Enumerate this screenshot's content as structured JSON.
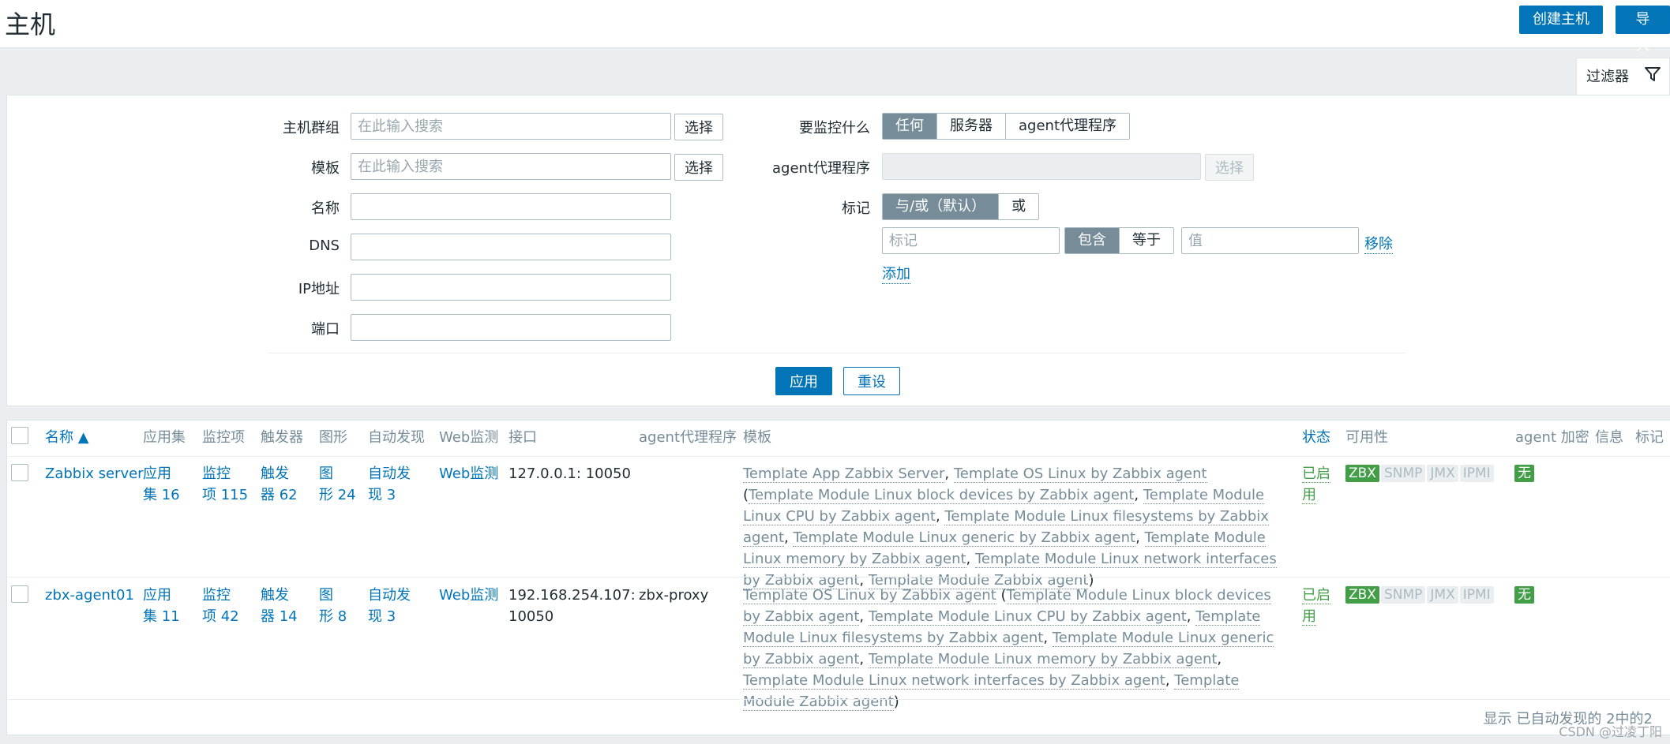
{
  "header": {
    "title": "主机",
    "create_label": "创建主机",
    "import_label": "导入"
  },
  "filter": {
    "tab_label": "过滤器",
    "host_group_label": "主机群组",
    "template_label": "模板",
    "name_label": "名称",
    "dns_label": "DNS",
    "ip_label": "IP地址",
    "port_label": "端口",
    "search_placeholder": "在此输入搜索",
    "select_label": "选择",
    "monitored_by_label": "要监控什么",
    "monitored_by_options": [
      "任何",
      "服务器",
      "agent代理程序"
    ],
    "proxy_label": "agent代理程序",
    "tags_label": "标记",
    "tag_eval_options": [
      "与/或（默认）",
      "或"
    ],
    "tag_placeholder": "标记",
    "tag_operators": [
      "包含",
      "等于"
    ],
    "value_placeholder": "值",
    "remove_label": "移除",
    "add_label": "添加",
    "apply_label": "应用",
    "reset_label": "重设"
  },
  "table": {
    "headers": {
      "name": "名称 ▲",
      "apps": "应用集",
      "items": "监控项",
      "triggers": "触发器",
      "graphs": "图形",
      "discovery": "自动发现",
      "web": "Web监测",
      "interface": "接口",
      "proxy": "agent代理程序",
      "templates": "模板",
      "status": "状态",
      "availability": "可用性",
      "encryption": "agent 加密",
      "info": "信息",
      "tags": "标记"
    },
    "availability_labels": [
      "ZBX",
      "SNMP",
      "JMX",
      "IPMI"
    ],
    "rows": [
      {
        "name": "Zabbix server",
        "apps_1": "应用",
        "apps_2": "集 16",
        "items_1": "监控",
        "items_2": "项 115",
        "triggers_1": "触发",
        "triggers_2": "器 62",
        "graphs_1": "图",
        "graphs_2": "形 24",
        "discovery_1": "自动发",
        "discovery_2": "现 3",
        "web": "Web监测",
        "interface_1": "127.0.0.1: 10050",
        "interface_2": "",
        "proxy": "",
        "templates": {
          "t0": "Template App Zabbix Server",
          "t1": "Template OS Linux by Zabbix agent",
          "t2": "Template Module Linux block devices by Zabbix agent",
          "t3": "Template Module Linux CPU by Zabbix agent",
          "t4": "Template Module Linux filesystems by Zabbix agent",
          "t5": "Template Module Linux generic by Zabbix agent",
          "t6": "Template Module Linux memory by Zabbix agent",
          "t7": "Template Module Linux network interfaces by Zabbix agent",
          "t8": "Template Module Zabbix agent"
        },
        "status": "已启用",
        "encryption": "无"
      },
      {
        "name": "zbx-agent01",
        "apps_1": "应用",
        "apps_2": "集 11",
        "items_1": "监控",
        "items_2": "项 42",
        "triggers_1": "触发",
        "triggers_2": "器 14",
        "graphs_1": "图",
        "graphs_2": "形 8",
        "discovery_1": "自动发",
        "discovery_2": "现 3",
        "web": "Web监测",
        "interface_1": "192.168.254.107:",
        "interface_2": "10050",
        "proxy": "zbx-proxy",
        "templates": {
          "t1": "Template OS Linux by Zabbix agent",
          "t2": "Template Module Linux block devices by Zabbix agent",
          "t3": "Template Module Linux CPU by Zabbix agent",
          "t4": "Template Module Linux filesystems by Zabbix agent",
          "t5": "Template Module Linux generic by Zabbix agent",
          "t6": "Template Module Linux memory by Zabbix agent",
          "t7": "Template Module Linux network interfaces by Zabbix agent",
          "t8": "Template Module Zabbix agent"
        },
        "status": "已启用",
        "encryption": "无"
      }
    ],
    "footer": "显示 已自动发现的 2中的2"
  },
  "watermark": "CSDN @过凌丁阳"
}
